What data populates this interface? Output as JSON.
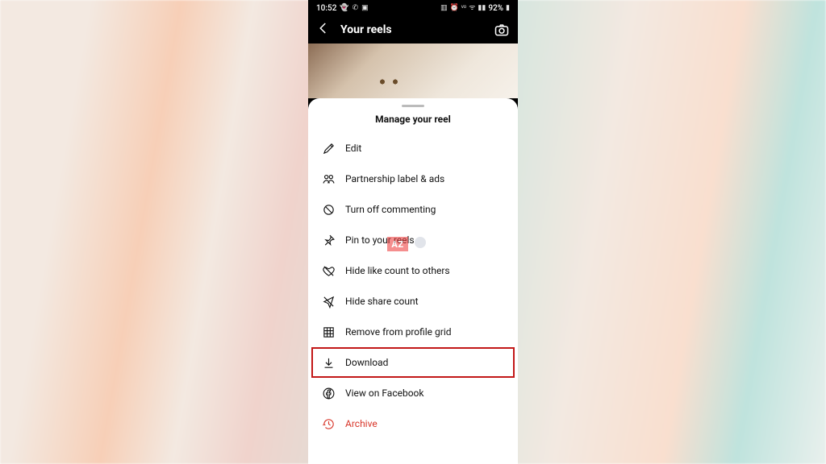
{
  "statusbar": {
    "time": "10:52",
    "battery_pct": "92%"
  },
  "header": {
    "title": "Your reels"
  },
  "sheet": {
    "title": "Manage your reel",
    "items": [
      {
        "label": "Edit"
      },
      {
        "label": "Partnership label & ads"
      },
      {
        "label": "Turn off commenting"
      },
      {
        "label": "Pin to your reels"
      },
      {
        "label": "Hide like count to others"
      },
      {
        "label": "Hide share count"
      },
      {
        "label": "Remove from profile grid"
      },
      {
        "label": "Download"
      },
      {
        "label": "View on Facebook"
      },
      {
        "label": "Archive"
      }
    ]
  },
  "watermark": {
    "text": "AZ"
  }
}
